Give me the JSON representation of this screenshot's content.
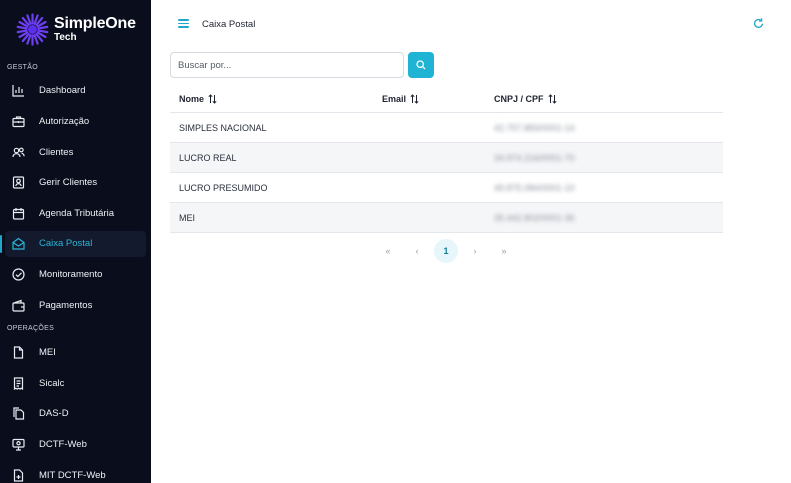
{
  "brand": {
    "name": "SimpleOne",
    "sub": "Tech",
    "accent": "#5b2ef0"
  },
  "sidebar": {
    "sections": [
      {
        "label": "GESTÃO"
      },
      {
        "label": "OPERAÇÕES"
      }
    ],
    "items": [
      {
        "label": "Dashboard",
        "icon": "bar-chart-icon"
      },
      {
        "label": "Autorização",
        "icon": "briefcase-icon"
      },
      {
        "label": "Clientes",
        "icon": "users-icon"
      },
      {
        "label": "Gerir Clientes",
        "icon": "contact-card-icon"
      },
      {
        "label": "Agenda Tributária",
        "icon": "calendar-icon"
      },
      {
        "label": "Caixa Postal",
        "icon": "mail-open-icon",
        "active": true
      },
      {
        "label": "Monitoramento",
        "icon": "check-circle-icon"
      },
      {
        "label": "Pagamentos",
        "icon": "wallet-icon"
      },
      {
        "label": "MEI",
        "icon": "file-icon"
      },
      {
        "label": "Sicalc",
        "icon": "receipt-icon"
      },
      {
        "label": "DAS-D",
        "icon": "files-icon"
      },
      {
        "label": "DCTF-Web",
        "icon": "monitor-icon"
      },
      {
        "label": "MIT DCTF-Web",
        "icon": "file-plus-icon"
      }
    ]
  },
  "header": {
    "title": "Caixa Postal"
  },
  "search": {
    "placeholder": "Buscar por..."
  },
  "table": {
    "columns": [
      "Nome",
      "Email",
      "CNPJ / CPF"
    ],
    "rows": [
      {
        "nome": "SIMPLES NACIONAL",
        "email": "",
        "cnpj": "42.757.883/0001-14"
      },
      {
        "nome": "LUCRO REAL",
        "email": "",
        "cnpj": "34.974.216/0001-70"
      },
      {
        "nome": "LUCRO PRESUMIDO",
        "email": "",
        "cnpj": "49.875.084/0001-10"
      },
      {
        "nome": "MEI",
        "email": "",
        "cnpj": "35.442.802/0001-36"
      }
    ]
  },
  "pagination": {
    "first": "«",
    "prev": "‹",
    "current": "1",
    "next": "›",
    "last": "»"
  },
  "colors": {
    "sidebar_bg": "#0a0e1c",
    "accent": "#1fb4d4",
    "active_text": "#2bb6d6"
  }
}
